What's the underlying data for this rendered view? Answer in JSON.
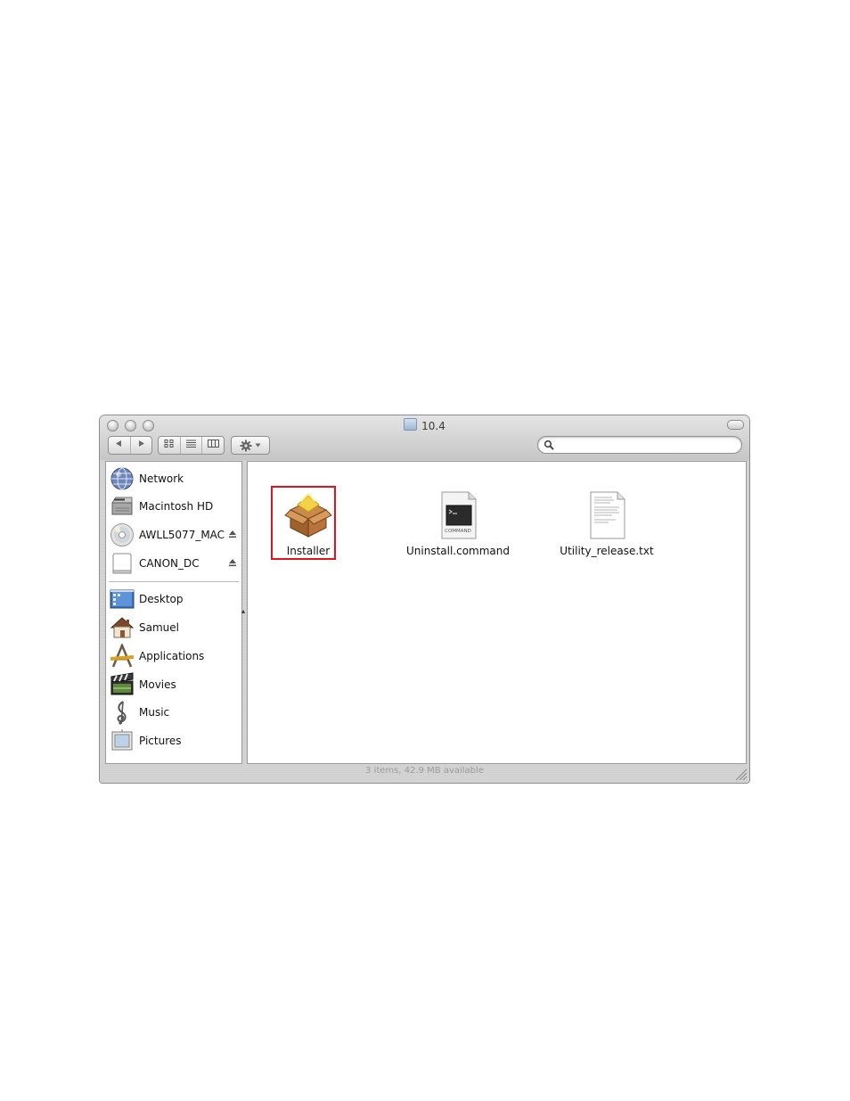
{
  "window": {
    "title": "10.4",
    "status_text": "3 items, 42.9 MB available"
  },
  "toolbar": {
    "back_icon": "left-triangle-icon",
    "forward_icon": "right-triangle-icon",
    "view_icons": [
      "icon-view-icon",
      "list-view-icon",
      "column-view-icon"
    ],
    "action_icon": "gear-icon",
    "search": {
      "value": "",
      "placeholder": ""
    }
  },
  "sidebar": {
    "devices": [
      {
        "label": "Network",
        "icon": "network-globe-icon"
      },
      {
        "label": "Macintosh HD",
        "icon": "hard-drive-icon"
      },
      {
        "label": "AWLL5077_MAC",
        "icon": "cd-disc-icon",
        "ejectable": true
      },
      {
        "label": "CANON_DC",
        "icon": "removable-disk-icon",
        "ejectable": true
      }
    ],
    "places": [
      {
        "label": "Desktop",
        "icon": "desktop-icon"
      },
      {
        "label": "Samuel",
        "icon": "home-icon"
      },
      {
        "label": "Applications",
        "icon": "applications-icon"
      },
      {
        "label": "Movies",
        "icon": "clapboard-icon"
      },
      {
        "label": "Music",
        "icon": "music-note-icon"
      },
      {
        "label": "Pictures",
        "icon": "picture-frame-icon"
      }
    ]
  },
  "files": [
    {
      "name": "Installer",
      "icon": "package-box-icon",
      "highlighted": true
    },
    {
      "name": "Uninstall.command",
      "icon": "command-file-icon",
      "icon_caption": "COMMAND"
    },
    {
      "name": "Utility_release.txt",
      "icon": "text-document-icon"
    }
  ],
  "colors": {
    "highlight": "#e0141e"
  }
}
